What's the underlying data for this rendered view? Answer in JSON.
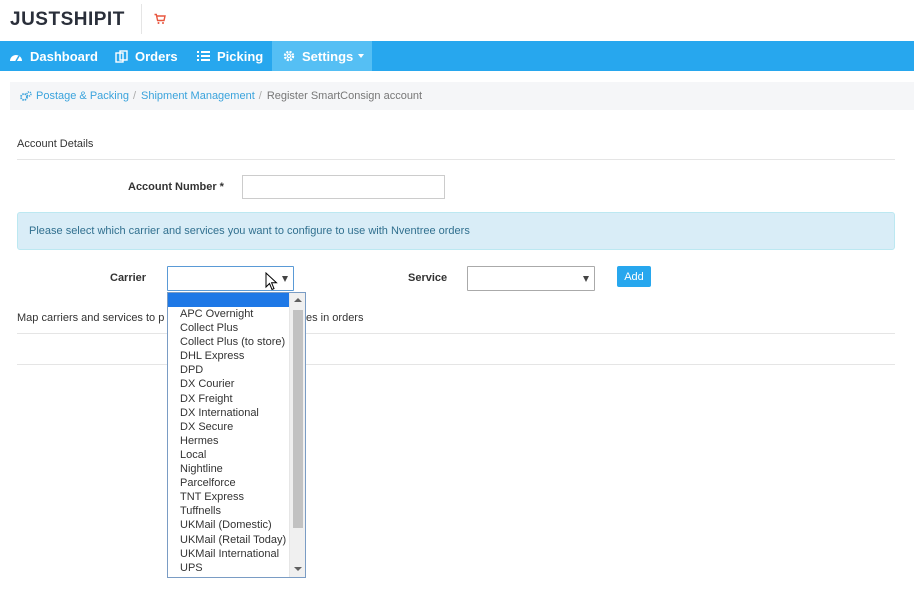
{
  "app": {
    "logo": "JUSTSHIPIT",
    "cart_icon": "shopping-cart-icon"
  },
  "nav": {
    "dashboard": "Dashboard",
    "orders": "Orders",
    "picking": "Picking",
    "settings": "Settings",
    "active_color": "#55bff4",
    "bar_color": "#27a7ee"
  },
  "breadcrumb": {
    "item1": "Postage & Packing",
    "item2": "Shipment Management",
    "current": "Register SmartConsign account"
  },
  "form": {
    "section_title": "Account Details",
    "account_number_label": "Account Number *",
    "account_number_value": "",
    "info_message": "Please select which carrier and services you want to configure to use with Nventree orders",
    "carrier_label": "Carrier",
    "service_label": "Service",
    "add_button": "Add",
    "map_text": "Map carriers and services to p"
  },
  "map_text_tail": "es in orders",
  "carrier_options": [
    "APC Overnight",
    "Collect Plus",
    "Collect Plus (to store)",
    "DHL Express",
    "DPD",
    "DX Courier",
    "DX Freight",
    "DX International",
    "DX Secure",
    "Hermes",
    "Local",
    "Nightline",
    "Parcelforce",
    "TNT Express",
    "Tuffnells",
    "UKMail (Domestic)",
    "UKMail (Retail Today)",
    "UKMail International",
    "UPS"
  ]
}
